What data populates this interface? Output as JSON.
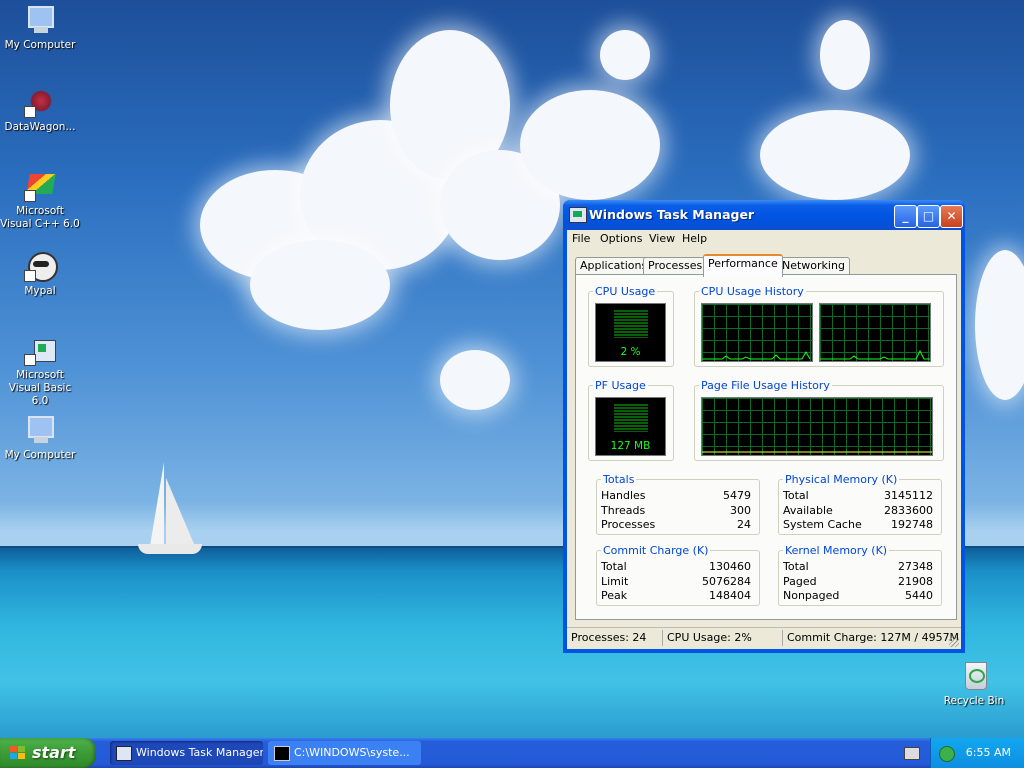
{
  "desktop": {
    "icons": [
      {
        "label": "My Computer"
      },
      {
        "label": "DataWagon..."
      },
      {
        "label": "Microsoft Visual C++ 6.0"
      },
      {
        "label": "Mypal"
      },
      {
        "label": "Microsoft Visual Basic 6.0"
      },
      {
        "label": "My Computer"
      },
      {
        "label": "Recycle Bin"
      }
    ]
  },
  "window": {
    "title": "Windows Task Manager",
    "buttons": {
      "minimize": "_",
      "maximize": "□",
      "close": "✕"
    },
    "menu": [
      "File",
      "Options",
      "View",
      "Help"
    ],
    "tabs": [
      "Applications",
      "Processes",
      "Performance",
      "Networking"
    ],
    "active_tab": "Performance",
    "groups": {
      "cpu_usage": {
        "label": "CPU Usage",
        "value": "2 %"
      },
      "cpu_history": {
        "label": "CPU Usage History"
      },
      "pf_usage": {
        "label": "PF Usage",
        "value": "127 MB"
      },
      "pf_history": {
        "label": "Page File Usage History"
      }
    },
    "totals": {
      "label": "Totals",
      "rows": [
        {
          "k": "Handles",
          "v": "5479"
        },
        {
          "k": "Threads",
          "v": "300"
        },
        {
          "k": "Processes",
          "v": "24"
        }
      ]
    },
    "physical": {
      "label": "Physical Memory (K)",
      "rows": [
        {
          "k": "Total",
          "v": "3145112"
        },
        {
          "k": "Available",
          "v": "2833600"
        },
        {
          "k": "System Cache",
          "v": "192748"
        }
      ]
    },
    "commit": {
      "label": "Commit Charge (K)",
      "rows": [
        {
          "k": "Total",
          "v": "130460"
        },
        {
          "k": "Limit",
          "v": "5076284"
        },
        {
          "k": "Peak",
          "v": "148404"
        }
      ]
    },
    "kernel": {
      "label": "Kernel Memory (K)",
      "rows": [
        {
          "k": "Total",
          "v": "27348"
        },
        {
          "k": "Paged",
          "v": "21908"
        },
        {
          "k": "Nonpaged",
          "v": "5440"
        }
      ]
    },
    "status": {
      "processes": "Processes: 24",
      "cpu": "CPU Usage: 2%",
      "commit": "Commit Charge: 127M / 4957M"
    }
  },
  "taskbar": {
    "start_label": "start",
    "items": [
      {
        "label": "Windows Task Manager",
        "active": true
      },
      {
        "label": "C:\\WINDOWS\\syste...",
        "active": false
      }
    ],
    "clock": "6:55 AM"
  },
  "colors": {
    "title_blue": "#0054e3",
    "group_label": "#0046d5",
    "meter_green": "#19ff19",
    "start_green": "#3c9b37"
  }
}
